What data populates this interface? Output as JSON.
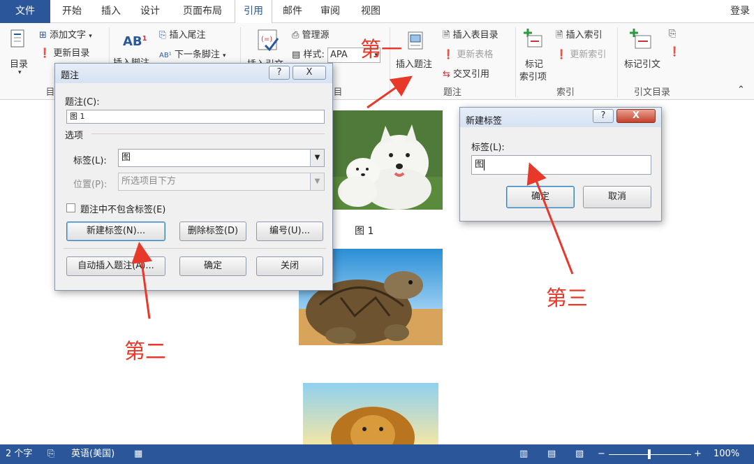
{
  "tabs": {
    "file": "文件",
    "home": "开始",
    "insert": "插入",
    "design": "设计",
    "layout": "页面布局",
    "references": "引用",
    "mailings": "邮件",
    "review": "审阅",
    "view": "视图",
    "login": "登录"
  },
  "ribbon": {
    "toc": "目录",
    "add_text": "添加文字",
    "update_toc": "更新目录",
    "group_toc": "目",
    "insert_footnote": "插入脚注",
    "insert_endnote": "插入尾注",
    "next_footnote": "下一条脚注",
    "insert_citation": "插入引文",
    "manage_sources": "管理源",
    "style_label": "样式:",
    "style_value": "APA",
    "insert_caption": "插入题注",
    "insert_table_of_figures": "插入表目录",
    "update_table": "更新表格",
    "cross_reference": "交叉引用",
    "group_captions": "题注",
    "mark_entry_1": "标记",
    "mark_entry_2": "索引项",
    "insert_index": "插入索引",
    "update_index": "更新索引",
    "group_index": "索引",
    "mark_citation": "标记引文",
    "group_toa": "引文目录",
    "group_citation_partial": "目"
  },
  "document": {
    "figure1_caption": "图 1"
  },
  "caption_dialog": {
    "title": "题注",
    "help": "?",
    "close": "X",
    "caption_label": "题注(C):",
    "caption_value": "图 1",
    "options_heading": "选项",
    "label_label": "标签(L):",
    "label_value": "图",
    "position_label": "位置(P):",
    "position_value": "所选项目下方",
    "exclude_label": "题注中不包含标签(E)",
    "new_label_btn": "新建标签(N)...",
    "delete_label_btn": "删除标签(D)",
    "numbering_btn": "编号(U)...",
    "autocaption_btn": "自动插入题注(A)...",
    "ok_btn": "确定",
    "close_btn": "关闭"
  },
  "new_label_dialog": {
    "title": "新建标签",
    "help": "?",
    "close": "X",
    "label_label": "标签(L):",
    "label_value": "图",
    "ok_btn": "确定",
    "cancel_btn": "取消"
  },
  "annotations": {
    "first": "第一",
    "second": "第二",
    "third": "第三",
    "color": "#e8382a"
  },
  "statusbar": {
    "word_count": "2 个字",
    "language": "英语(美国)",
    "zoom": "100%"
  },
  "colors": {
    "accent": "#2b579a"
  }
}
